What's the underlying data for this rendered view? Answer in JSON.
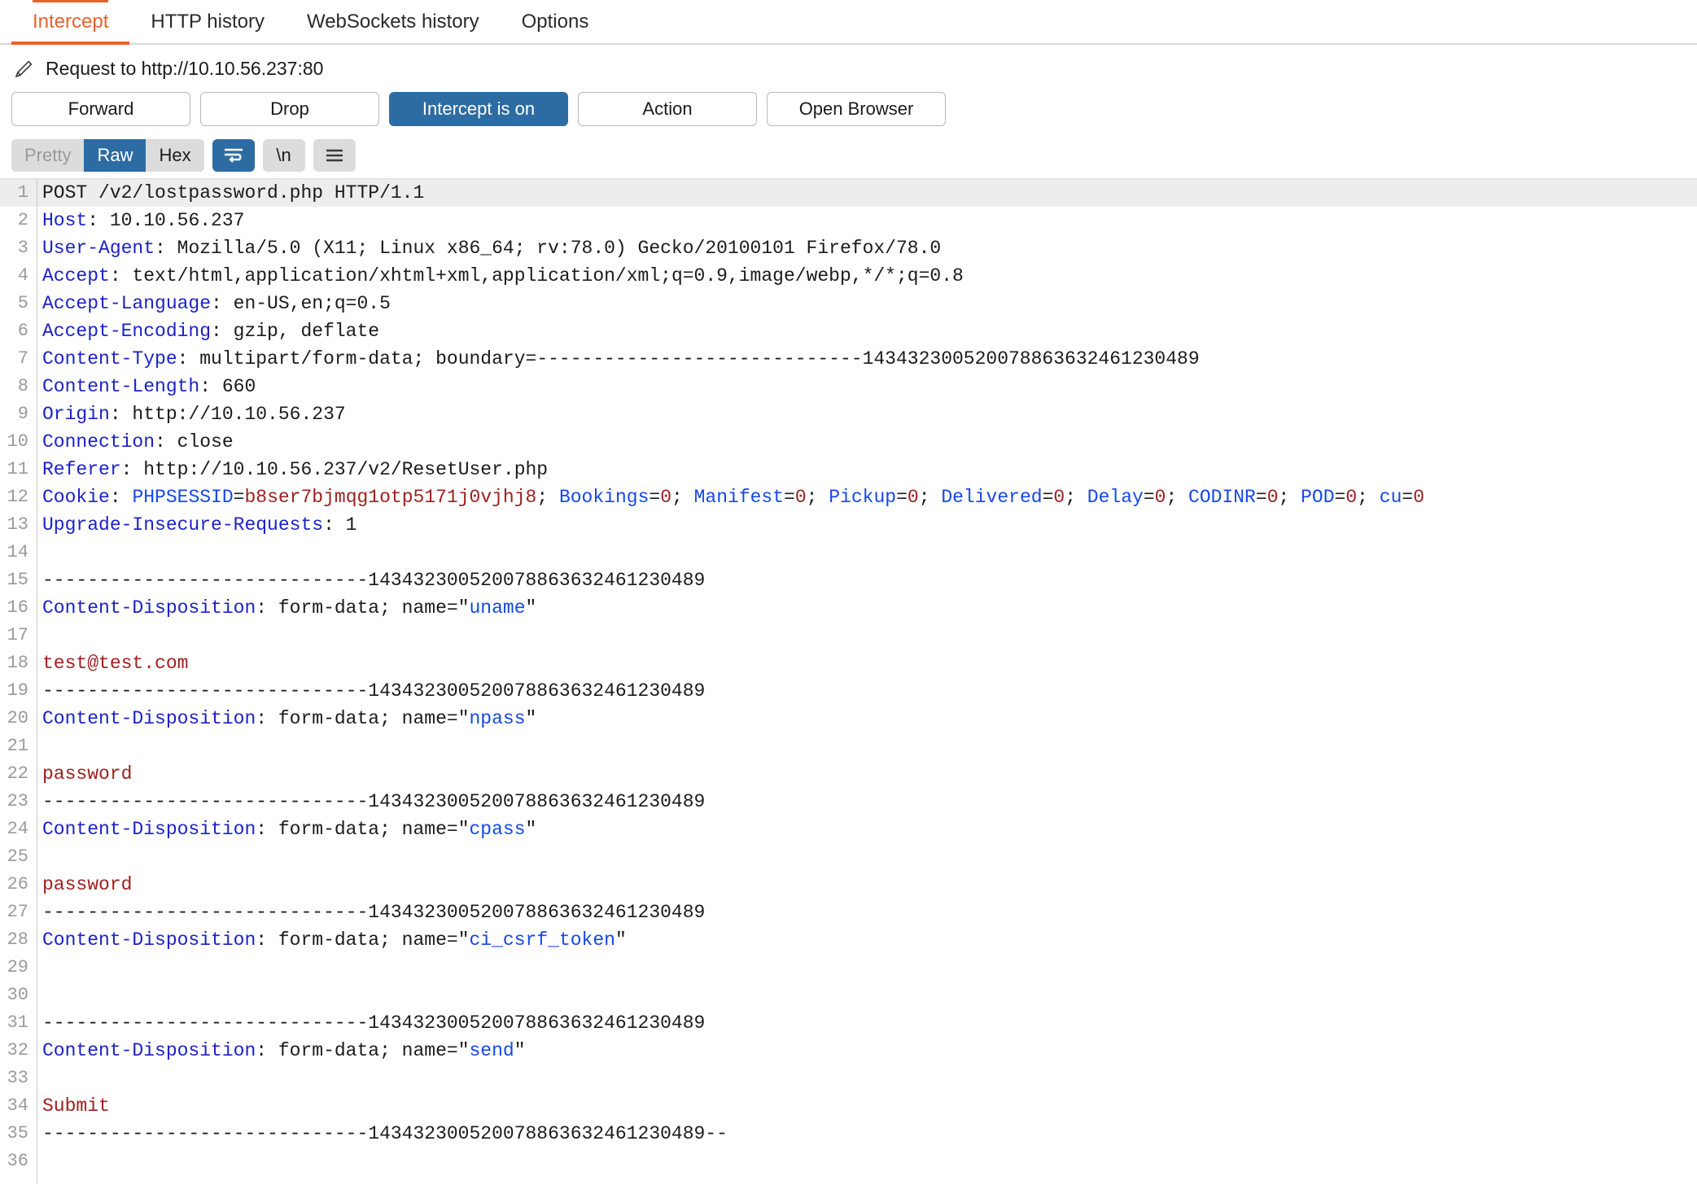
{
  "tabs": [
    {
      "label": "Intercept",
      "active": true
    },
    {
      "label": "HTTP history",
      "active": false
    },
    {
      "label": "WebSockets history",
      "active": false
    },
    {
      "label": "Options",
      "active": false
    }
  ],
  "request_header": {
    "icon": "pencil-icon",
    "title": "Request to http://10.10.56.237:80"
  },
  "actions": {
    "forward": "Forward",
    "drop": "Drop",
    "intercept_toggle": "Intercept is on",
    "action": "Action",
    "open_browser": "Open Browser"
  },
  "format_bar": {
    "pretty": "Pretty",
    "raw": "Raw",
    "hex": "Hex",
    "wrap_icon": "word-wrap-icon",
    "newline": "\\n",
    "menu_icon": "hamburger-menu-icon"
  },
  "colors": {
    "accent_orange": "#e8622c",
    "accent_blue": "#2d6ca2",
    "header_key_blue": "#1c22c8",
    "param_name_blue": "#1548e8",
    "param_value_red": "#a02020",
    "gutter_gray": "#9b9b9b"
  },
  "boundary": "143432300520078863632461230489",
  "boundary_dashes": "-----------------------------",
  "editor": {
    "lines": [
      {
        "n": 1,
        "hl": true,
        "parts": [
          {
            "t": "POST /v2/lostpassword.php HTTP/1.1",
            "c": "hv"
          }
        ]
      },
      {
        "n": 2,
        "parts": [
          {
            "t": "Host",
            "c": "hk"
          },
          {
            "t": ": 10.10.56.237",
            "c": "hv"
          }
        ]
      },
      {
        "n": 3,
        "parts": [
          {
            "t": "User-Agent",
            "c": "hk"
          },
          {
            "t": ": Mozilla/5.0 (X11; Linux x86_64; rv:78.0) Gecko/20100101 Firefox/78.0",
            "c": "hv"
          }
        ]
      },
      {
        "n": 4,
        "parts": [
          {
            "t": "Accept",
            "c": "hk"
          },
          {
            "t": ": text/html,application/xhtml+xml,application/xml;q=0.9,image/webp,*/*;q=0.8",
            "c": "hv"
          }
        ]
      },
      {
        "n": 5,
        "parts": [
          {
            "t": "Accept-Language",
            "c": "hk"
          },
          {
            "t": ": en-US,en;q=0.5",
            "c": "hv"
          }
        ]
      },
      {
        "n": 6,
        "parts": [
          {
            "t": "Accept-Encoding",
            "c": "hk"
          },
          {
            "t": ": gzip, deflate",
            "c": "hv"
          }
        ]
      },
      {
        "n": 7,
        "parts": [
          {
            "t": "Content-Type",
            "c": "hk"
          },
          {
            "t": ": multipart/form-data; boundary=-----------------------------143432300520078863632461230489",
            "c": "hv"
          }
        ]
      },
      {
        "n": 8,
        "parts": [
          {
            "t": "Content-Length",
            "c": "hk"
          },
          {
            "t": ": 660",
            "c": "hv"
          }
        ]
      },
      {
        "n": 9,
        "parts": [
          {
            "t": "Origin",
            "c": "hk"
          },
          {
            "t": ": http://10.10.56.237",
            "c": "hv"
          }
        ]
      },
      {
        "n": 10,
        "parts": [
          {
            "t": "Connection",
            "c": "hk"
          },
          {
            "t": ": close",
            "c": "hv"
          }
        ]
      },
      {
        "n": 11,
        "parts": [
          {
            "t": "Referer",
            "c": "hk"
          },
          {
            "t": ": http://10.10.56.237/v2/ResetUser.php",
            "c": "hv"
          }
        ]
      },
      {
        "n": 12,
        "parts": [
          {
            "t": "Cookie",
            "c": "hk"
          },
          {
            "t": ": ",
            "c": "hv"
          },
          {
            "t": "PHPSESSID",
            "c": "pk"
          },
          {
            "t": "=",
            "c": "hv"
          },
          {
            "t": "b8ser7bjmqg1otp5171j0vjhj8",
            "c": "pv"
          },
          {
            "t": "; ",
            "c": "hv"
          },
          {
            "t": "Bookings",
            "c": "pk"
          },
          {
            "t": "=",
            "c": "hv"
          },
          {
            "t": "0",
            "c": "pv"
          },
          {
            "t": "; ",
            "c": "hv"
          },
          {
            "t": "Manifest",
            "c": "pk"
          },
          {
            "t": "=",
            "c": "hv"
          },
          {
            "t": "0",
            "c": "pv"
          },
          {
            "t": "; ",
            "c": "hv"
          },
          {
            "t": "Pickup",
            "c": "pk"
          },
          {
            "t": "=",
            "c": "hv"
          },
          {
            "t": "0",
            "c": "pv"
          },
          {
            "t": "; ",
            "c": "hv"
          },
          {
            "t": "Delivered",
            "c": "pk"
          },
          {
            "t": "=",
            "c": "hv"
          },
          {
            "t": "0",
            "c": "pv"
          },
          {
            "t": "; ",
            "c": "hv"
          },
          {
            "t": "Delay",
            "c": "pk"
          },
          {
            "t": "=",
            "c": "hv"
          },
          {
            "t": "0",
            "c": "pv"
          },
          {
            "t": "; ",
            "c": "hv"
          },
          {
            "t": "CODINR",
            "c": "pk"
          },
          {
            "t": "=",
            "c": "hv"
          },
          {
            "t": "0",
            "c": "pv"
          },
          {
            "t": "; ",
            "c": "hv"
          },
          {
            "t": "POD",
            "c": "pk"
          },
          {
            "t": "=",
            "c": "hv"
          },
          {
            "t": "0",
            "c": "pv"
          },
          {
            "t": "; ",
            "c": "hv"
          },
          {
            "t": "cu",
            "c": "pk"
          },
          {
            "t": "=",
            "c": "hv"
          },
          {
            "t": "0",
            "c": "pv"
          }
        ]
      },
      {
        "n": 13,
        "parts": [
          {
            "t": "Upgrade-Insecure-Requests",
            "c": "hk"
          },
          {
            "t": ": 1",
            "c": "hv"
          }
        ]
      },
      {
        "n": 14,
        "parts": []
      },
      {
        "n": 15,
        "parts": [
          {
            "t": "-----------------------------143432300520078863632461230489",
            "c": "bnd"
          }
        ]
      },
      {
        "n": 16,
        "parts": [
          {
            "t": "Content-Disposition",
            "c": "hk"
          },
          {
            "t": ": form-data; name=\"",
            "c": "hv"
          },
          {
            "t": "uname",
            "c": "pk"
          },
          {
            "t": "\"",
            "c": "hv"
          }
        ]
      },
      {
        "n": 17,
        "parts": []
      },
      {
        "n": 18,
        "parts": [
          {
            "t": "test@test.com",
            "c": "pv"
          }
        ]
      },
      {
        "n": 19,
        "parts": [
          {
            "t": "-----------------------------143432300520078863632461230489",
            "c": "bnd"
          }
        ]
      },
      {
        "n": 20,
        "parts": [
          {
            "t": "Content-Disposition",
            "c": "hk"
          },
          {
            "t": ": form-data; name=\"",
            "c": "hv"
          },
          {
            "t": "npass",
            "c": "pk"
          },
          {
            "t": "\"",
            "c": "hv"
          }
        ]
      },
      {
        "n": 21,
        "parts": []
      },
      {
        "n": 22,
        "parts": [
          {
            "t": "password",
            "c": "pv"
          }
        ]
      },
      {
        "n": 23,
        "parts": [
          {
            "t": "-----------------------------143432300520078863632461230489",
            "c": "bnd"
          }
        ]
      },
      {
        "n": 24,
        "parts": [
          {
            "t": "Content-Disposition",
            "c": "hk"
          },
          {
            "t": ": form-data; name=\"",
            "c": "hv"
          },
          {
            "t": "cpass",
            "c": "pk"
          },
          {
            "t": "\"",
            "c": "hv"
          }
        ]
      },
      {
        "n": 25,
        "parts": []
      },
      {
        "n": 26,
        "parts": [
          {
            "t": "password",
            "c": "pv"
          }
        ]
      },
      {
        "n": 27,
        "parts": [
          {
            "t": "-----------------------------143432300520078863632461230489",
            "c": "bnd"
          }
        ]
      },
      {
        "n": 28,
        "parts": [
          {
            "t": "Content-Disposition",
            "c": "hk"
          },
          {
            "t": ": form-data; name=\"",
            "c": "hv"
          },
          {
            "t": "ci_csrf_token",
            "c": "pk"
          },
          {
            "t": "\"",
            "c": "hv"
          }
        ]
      },
      {
        "n": 29,
        "parts": []
      },
      {
        "n": 30,
        "parts": []
      },
      {
        "n": 31,
        "parts": [
          {
            "t": "-----------------------------143432300520078863632461230489",
            "c": "bnd"
          }
        ]
      },
      {
        "n": 32,
        "parts": [
          {
            "t": "Content-Disposition",
            "c": "hk"
          },
          {
            "t": ": form-data; name=\"",
            "c": "hv"
          },
          {
            "t": "send",
            "c": "pk"
          },
          {
            "t": "\"",
            "c": "hv"
          }
        ]
      },
      {
        "n": 33,
        "parts": []
      },
      {
        "n": 34,
        "parts": [
          {
            "t": "Submit",
            "c": "pv"
          }
        ]
      },
      {
        "n": 35,
        "parts": [
          {
            "t": "-----------------------------143432300520078863632461230489--",
            "c": "bnd"
          }
        ]
      },
      {
        "n": 36,
        "parts": []
      }
    ]
  }
}
